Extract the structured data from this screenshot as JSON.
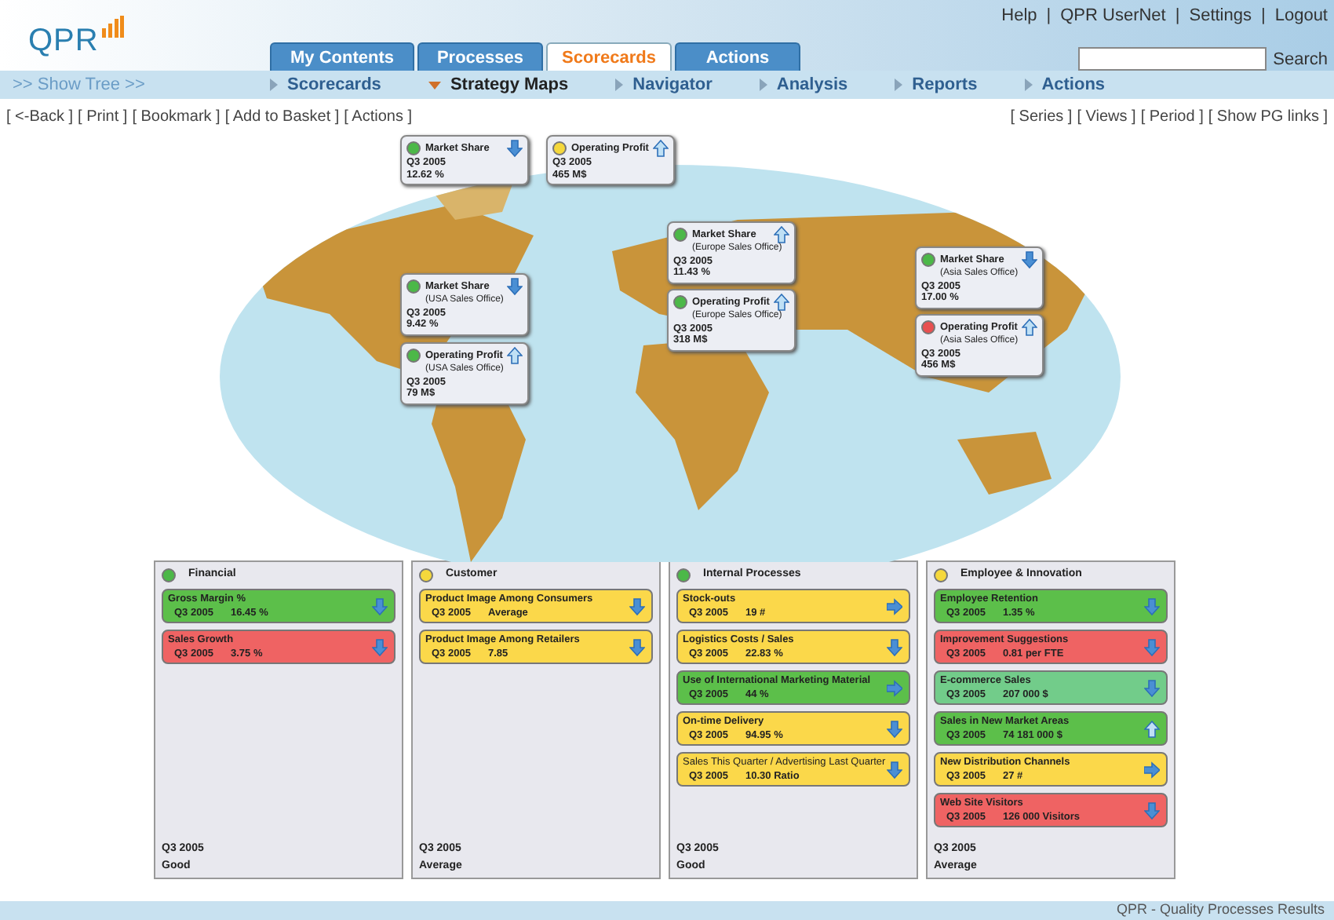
{
  "logo": "QPR",
  "top_links": [
    "Help",
    "QPR UserNet",
    "Settings",
    "Logout"
  ],
  "link_separator": "|",
  "search": {
    "button": "Search"
  },
  "tabs": [
    {
      "label": "My Contents",
      "selected": false
    },
    {
      "label": "Processes",
      "selected": false
    },
    {
      "label": "Scorecards",
      "selected": true
    },
    {
      "label": "Actions",
      "selected": false
    }
  ],
  "show_tree": ">> Show Tree >>",
  "subnav": [
    {
      "label": "Scorecards",
      "selected": false
    },
    {
      "label": "Strategy Maps",
      "selected": true
    },
    {
      "label": "Navigator",
      "selected": false
    },
    {
      "label": "Analysis",
      "selected": false
    },
    {
      "label": "Reports",
      "selected": false
    },
    {
      "label": "Actions",
      "selected": false
    }
  ],
  "toolbar_left": [
    "[ <-Back ]",
    "[ Print ]",
    "[ Bookmark ]",
    "[ Add to Basket ]",
    "[ Actions ]"
  ],
  "toolbar_right": [
    "[ Series ]",
    "[ Views ]",
    "[ Period ]",
    "[ Show PG links ]"
  ],
  "map_indicators": [
    {
      "title": "Market Share",
      "period": "Q3 2005",
      "value": "12.62 %",
      "color": "#4cb848",
      "kind": "down"
    },
    {
      "title": "Operating Profit",
      "period": "Q3 2005",
      "value": "465 M$",
      "color": "#f5d83c",
      "kind": "up"
    },
    {
      "title": "Market Share",
      "subtitle": "(Europe Sales Office)",
      "period": "Q3 2005",
      "value": "11.43 %",
      "color": "#4cb848",
      "kind": "up"
    },
    {
      "title": "Operating Profit",
      "subtitle": "(Europe Sales Office)",
      "period": "Q3 2005",
      "value": "318 M$",
      "color": "#4cb848",
      "kind": "up"
    },
    {
      "title": "Market Share",
      "subtitle": "(USA Sales Office)",
      "period": "Q3 2005",
      "value": "9.42 %",
      "color": "#4cb848",
      "kind": "down"
    },
    {
      "title": "Operating Profit",
      "subtitle": "(USA Sales Office)",
      "period": "Q3 2005",
      "value": "79 M$",
      "color": "#4cb848",
      "kind": "up"
    },
    {
      "title": "Market Share",
      "subtitle": "(Asia Sales Office)",
      "period": "Q3 2005",
      "value": "17.00 %",
      "color": "#4cb848",
      "kind": "down"
    },
    {
      "title": "Operating Profit",
      "subtitle": "(Asia Sales Office)",
      "period": "Q3 2005",
      "value": "456 M$",
      "color": "#e85050",
      "kind": "up"
    }
  ],
  "perspectives": [
    {
      "name": "Financial",
      "color": "#4cb848",
      "period": "Q3 2005",
      "status": "Good",
      "indicators": [
        {
          "name": "Gross Margin %",
          "period": "Q3 2005",
          "value": "16.45 %",
          "color": "#5cbf4a",
          "kind": "down",
          "bold": true
        },
        {
          "name": "Sales Growth",
          "period": "Q3 2005",
          "value": "3.75 %",
          "color": "#ef6363",
          "kind": "down",
          "bold": true
        }
      ]
    },
    {
      "name": "Customer",
      "color": "#f5d83c",
      "period": "Q3 2005",
      "status": "Average",
      "indicators": [
        {
          "name": "Product Image Among Consumers",
          "period": "Q3 2005",
          "value": "Average",
          "color": "#fbd84a",
          "kind": "down",
          "bold": true
        },
        {
          "name": "Product Image Among Retailers",
          "period": "Q3 2005",
          "value": "7.85",
          "color": "#fbd84a",
          "kind": "down",
          "bold": true
        }
      ]
    },
    {
      "name": "Internal Processes",
      "color": "#4cb848",
      "period": "Q3 2005",
      "status": "Good",
      "indicators": [
        {
          "name": "Stock-outs",
          "period": "Q3 2005",
          "value": "19 #",
          "color": "#fbd84a",
          "kind": "right",
          "bold": true
        },
        {
          "name": "Logistics Costs / Sales",
          "period": "Q3 2005",
          "value": "22.83 %",
          "color": "#fbd84a",
          "kind": "down",
          "bold": true
        },
        {
          "name": "Use of International Marketing Material",
          "period": "Q3 2005",
          "value": "44 %",
          "color": "#5cbf4a",
          "kind": "right",
          "bold": true
        },
        {
          "name": "On-time Delivery",
          "period": "Q3 2005",
          "value": "94.95 %",
          "color": "#fbd84a",
          "kind": "down",
          "bold": true
        },
        {
          "name": "Sales This Quarter / Advertising Last Quarter",
          "period": "Q3 2005",
          "value": "10.30 Ratio",
          "color": "#fbd84a",
          "kind": "down",
          "bold": false
        }
      ]
    },
    {
      "name": "Employee & Innovation",
      "color": "#f5d83c",
      "period": "Q3 2005",
      "status": "Average",
      "indicators": [
        {
          "name": "Employee Retention",
          "period": "Q3 2005",
          "value": "1.35 %",
          "color": "#5cbf4a",
          "kind": "down",
          "bold": true
        },
        {
          "name": "Improvement Suggestions",
          "period": "Q3 2005",
          "value": "0.81 per FTE",
          "color": "#ef6363",
          "kind": "down",
          "bold": true
        },
        {
          "name": "E-commerce Sales",
          "period": "Q3 2005",
          "value": "207 000 $",
          "color": "#72cc8a",
          "kind": "down",
          "bold": true
        },
        {
          "name": "Sales in New Market Areas",
          "period": "Q3 2005",
          "value": "74 181 000 $",
          "color": "#5cbf4a",
          "kind": "up",
          "bold": true
        },
        {
          "name": "New Distribution Channels",
          "period": "Q3 2005",
          "value": "27 #",
          "color": "#fbd84a",
          "kind": "right",
          "bold": true
        },
        {
          "name": "Web Site Visitors",
          "period": "Q3 2005",
          "value": "126 000 Visitors",
          "color": "#ef6363",
          "kind": "down",
          "bold": true
        }
      ]
    }
  ],
  "footer": "QPR - Quality Processes Results"
}
